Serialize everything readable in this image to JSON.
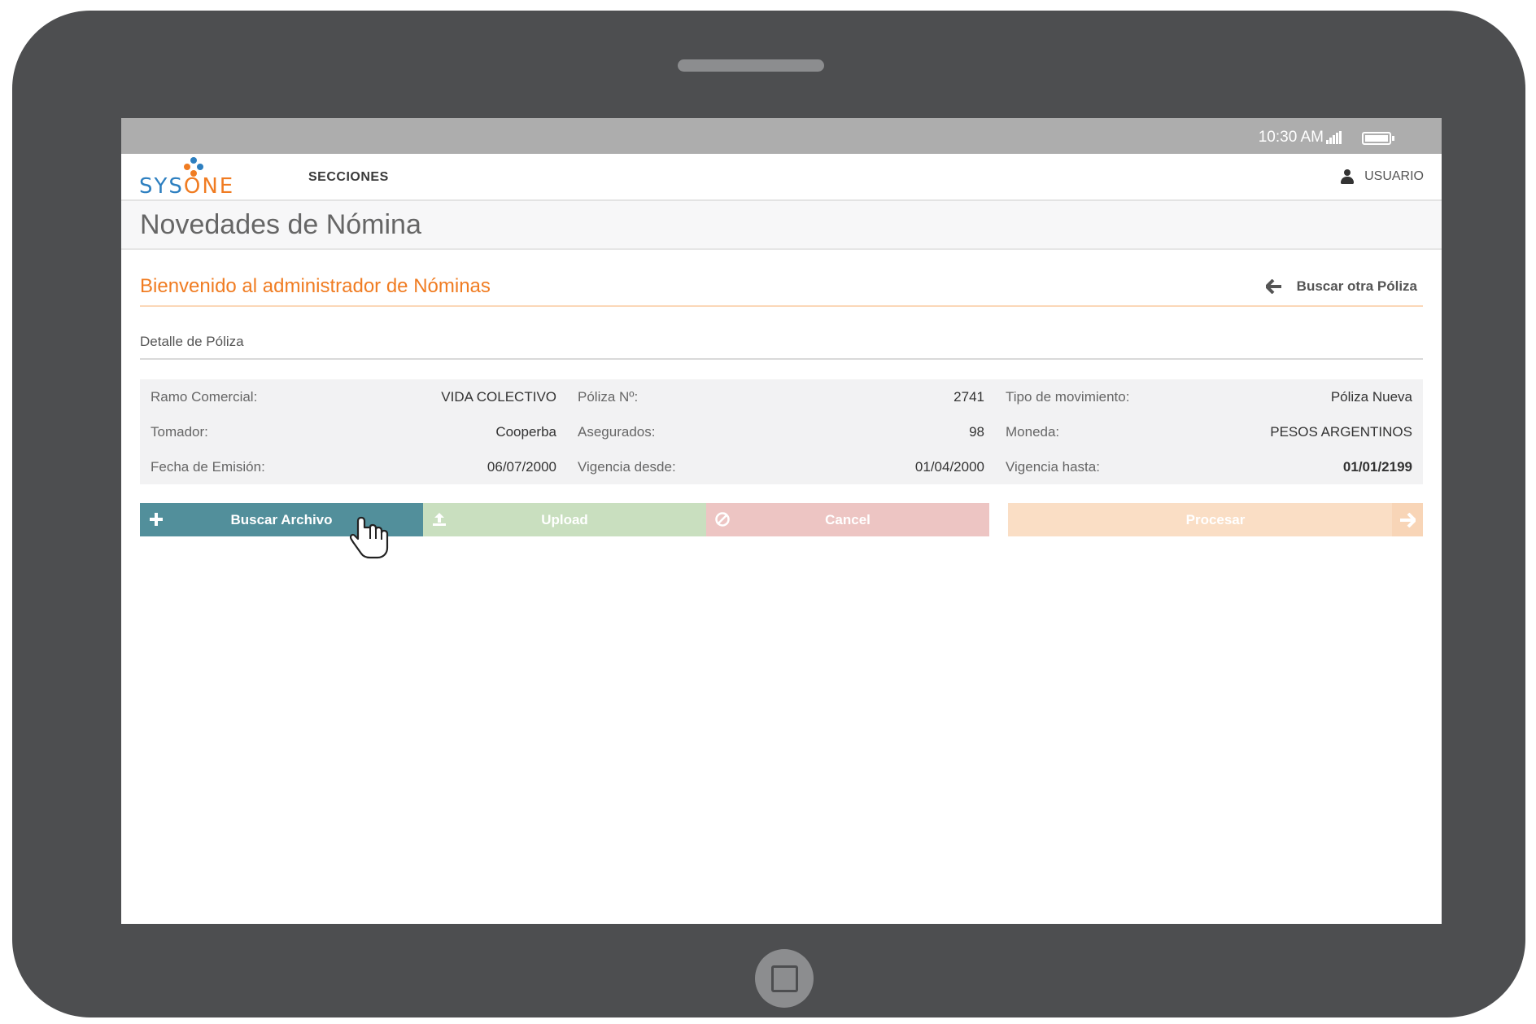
{
  "status_bar": {
    "time": "10:30 AM"
  },
  "navbar": {
    "logo": {
      "text_main": "SYS",
      "text_accent": "ONE"
    },
    "secciones_label": "SECCIONES",
    "user_label": "USUARIO"
  },
  "page": {
    "title": "Novedades de Nómina",
    "welcome": "Bienvenido al administrador de Nóminas",
    "back_link": "Buscar otra Póliza",
    "section_label": "Detalle de Póliza"
  },
  "details": [
    [
      {
        "label": "Ramo Comercial:",
        "value": "VIDA COLECTIVO"
      },
      {
        "label": "Póliza Nº:",
        "value": "2741"
      },
      {
        "label": "Tipo de movimiento:",
        "value": "Póliza Nueva"
      }
    ],
    [
      {
        "label": "Tomador:",
        "value": "Cooperba"
      },
      {
        "label": "Asegurados:",
        "value": "98"
      },
      {
        "label": "Moneda:",
        "value": "PESOS ARGENTINOS"
      }
    ],
    [
      {
        "label": "Fecha de Emisión:",
        "value": "06/07/2000"
      },
      {
        "label": "Vigencia desde:",
        "value": "01/04/2000"
      },
      {
        "label": "Vigencia hasta:",
        "value": "01/01/2199"
      }
    ]
  ],
  "buttons": {
    "buscar": "Buscar Archivo",
    "upload": "Upload",
    "cancel": "Cancel",
    "procesar": "Procesar"
  },
  "colors": {
    "accent": "#f07c22",
    "buscar": "#528f9b",
    "upload": "#c9dfbf",
    "cancel": "#edc5c3",
    "procesar": "#fadec5",
    "device": "#4d4e50"
  },
  "icons": [
    "plus-icon",
    "upload-icon",
    "ban-icon",
    "arrow-right-icon",
    "arrow-left-icon",
    "user-icon",
    "signal-icon",
    "battery-icon",
    "hand-pointer-cursor"
  ]
}
